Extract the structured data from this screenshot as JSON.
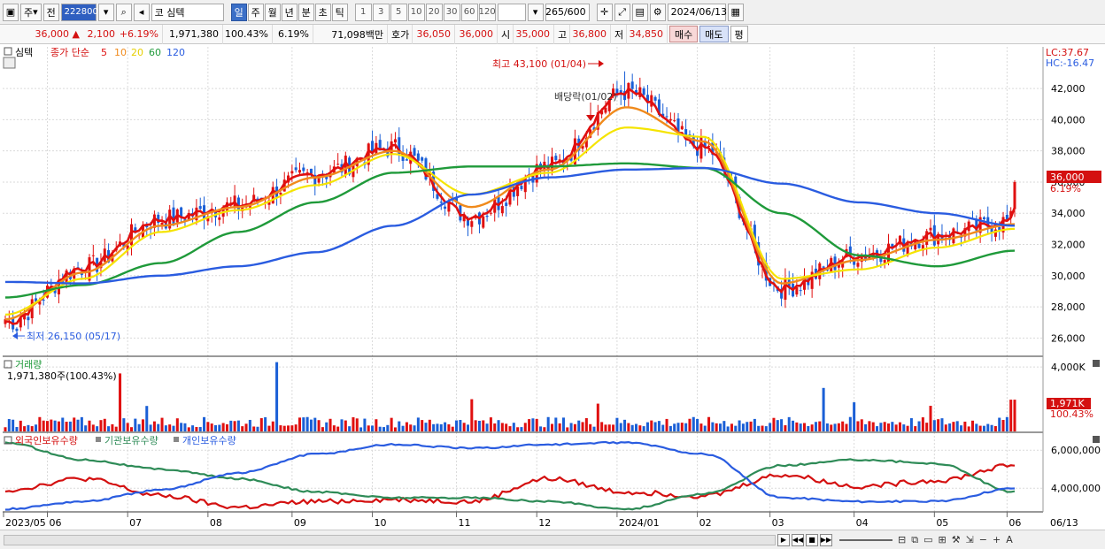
{
  "toolbar": {
    "type_label": "주",
    "prev_label": "전",
    "code_value": "222800",
    "name_value": "코 심텍",
    "periods": [
      "일",
      "주",
      "월",
      "년",
      "분",
      "초",
      "틱"
    ],
    "active_period": "일",
    "numbers": [
      "1",
      "3",
      "5",
      "10",
      "20",
      "30",
      "60",
      "120"
    ],
    "count_value": "265",
    "count_total": "/600",
    "date_value": "2024/06/13"
  },
  "pricebar": {
    "price": "36,000",
    "change": "2,100",
    "change_pct": "+6.19%",
    "volume": "1,971,380",
    "volume_ratio": "100.43%",
    "turnover": "6.19%",
    "amount": "71,098백만",
    "quote_label": "호가",
    "ask": "36,050",
    "bid": "36,000",
    "open_label": "시",
    "open": "35,000",
    "high_label": "고",
    "high": "36,800",
    "low_label": "저",
    "low": "34,850",
    "buy_label": "매수",
    "sell_label": "매도",
    "avg_label": "평"
  },
  "price_panel": {
    "name": "심텍",
    "ma_label": "종가 단순",
    "ma_periods": [
      "5",
      "10",
      "20",
      "60",
      "120"
    ],
    "lc_label": "LC:37.67",
    "hc_label": "HC:-16.47",
    "high_annotation": "최고 43,100 (01/04)",
    "low_annotation": "최저 26,150 (05/17)",
    "dividend_annotation": "배당락(01/02)",
    "current_price_label": "36,000",
    "current_pct_label": "6.19%"
  },
  "volume_panel": {
    "title": "거래량",
    "info": "1,971,380주(100.43%)",
    "current_label": "1,971K",
    "current_pct": "100.43%"
  },
  "holdings_panel": {
    "legend": [
      "외국인보유수량",
      "기관보유수량",
      "개인보유수량"
    ]
  },
  "x_axis": {
    "labels": [
      "2023/05",
      "06",
      "07",
      "08",
      "09",
      "10",
      "11",
      "12",
      "2024/01",
      "02",
      "03",
      "04",
      "05",
      "06"
    ],
    "right_label": "06/13"
  },
  "colors": {
    "up": "#e01010",
    "down": "#1a5fd6",
    "ma5": "#e01010",
    "ma10": "#f08a1c",
    "ma20": "#f5e400",
    "ma60": "#1f9a3a",
    "ma120": "#2a5ce0",
    "foreign": "#d41010",
    "institution": "#2e8b57",
    "individual": "#2a5ce0"
  },
  "chart_data": [
    {
      "type": "line",
      "title": "",
      "ylim": [
        25000,
        44500
      ],
      "y_ticks": [
        "42,000",
        "40,000",
        "38,000",
        "36,000",
        "34,000",
        "32,000",
        "30,000",
        "28,000",
        "26,000"
      ],
      "x": [
        "2023/05",
        "06",
        "07",
        "08",
        "09",
        "10",
        "11",
        "12",
        "2024/01",
        "02",
        "03",
        "04",
        "05",
        "06"
      ],
      "series": [
        {
          "name": "5",
          "values": [
            27000,
            30500,
            33600,
            34500,
            36500,
            38200,
            33800,
            37000,
            41800,
            38200,
            29200,
            31300,
            32600,
            33500
          ]
        },
        {
          "name": "10",
          "values": [
            27200,
            30200,
            33200,
            34400,
            36300,
            38000,
            34400,
            36800,
            40800,
            38600,
            29500,
            31000,
            32300,
            33300
          ]
        },
        {
          "name": "20",
          "values": [
            27500,
            29800,
            32800,
            34200,
            35800,
            37800,
            35200,
            36600,
            39500,
            38900,
            29800,
            30400,
            31800,
            33000
          ]
        },
        {
          "name": "60",
          "values": [
            28600,
            29400,
            30800,
            32800,
            34700,
            36600,
            37000,
            37000,
            37200,
            36900,
            34000,
            31300,
            30600,
            31600
          ]
        },
        {
          "name": "120",
          "values": [
            29600,
            29500,
            30000,
            30600,
            31500,
            33200,
            35200,
            36300,
            36800,
            36900,
            35900,
            34700,
            34000,
            33200
          ]
        }
      ],
      "high": 43100,
      "low": 26150,
      "last_close": 36000
    },
    {
      "type": "bar",
      "title": "거래량",
      "ylim": [
        0,
        4500000
      ],
      "y_ticks": [
        "4,000K"
      ],
      "last_value": 1971380
    },
    {
      "type": "line",
      "title": "",
      "ylim": [
        2800000,
        6800000
      ],
      "y_ticks": [
        "6,000,000",
        "4,000,000"
      ],
      "x": [
        "2023/05",
        "06",
        "07",
        "08",
        "09",
        "10",
        "11",
        "12",
        "2024/01",
        "02",
        "03",
        "04",
        "05",
        "06"
      ],
      "series": [
        {
          "name": "외국인보유수량",
          "values": [
            3900000,
            4500000,
            3600000,
            3000000,
            3300000,
            3400000,
            3300000,
            4500000,
            3800000,
            3600000,
            4700000,
            4100000,
            4400000,
            5200000
          ]
        },
        {
          "name": "기관보유수량",
          "values": [
            6400000,
            5500000,
            5000000,
            4500000,
            3800000,
            3500000,
            3500000,
            3300000,
            2900000,
            3700000,
            5200000,
            5500000,
            5300000,
            3800000
          ]
        },
        {
          "name": "개인보유수량",
          "values": [
            2900000,
            3300000,
            3900000,
            4800000,
            5800000,
            6300000,
            6100000,
            6300000,
            6400000,
            5800000,
            3500000,
            3300000,
            3300000,
            4000000
          ]
        }
      ]
    }
  ]
}
